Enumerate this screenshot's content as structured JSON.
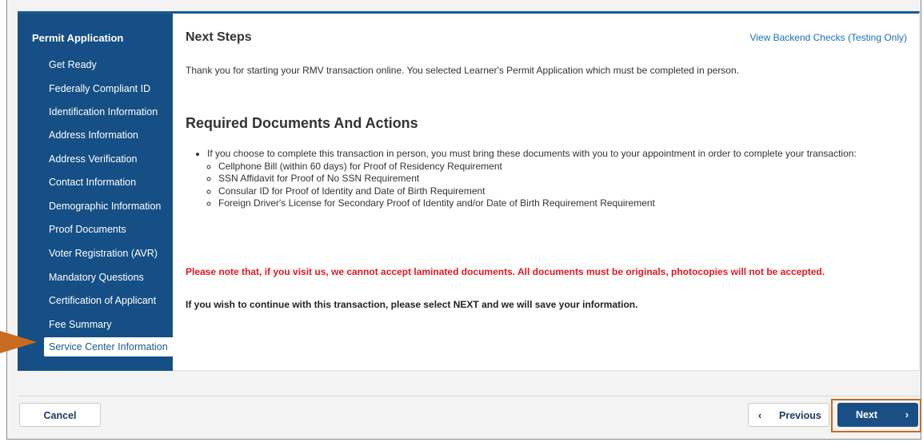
{
  "sidebar": {
    "title": "Permit Application",
    "items": [
      {
        "label": "Get Ready"
      },
      {
        "label": "Federally Compliant ID"
      },
      {
        "label": "Identification Information"
      },
      {
        "label": "Address Information"
      },
      {
        "label": "Address Verification"
      },
      {
        "label": "Contact Information"
      },
      {
        "label": "Demographic Information"
      },
      {
        "label": "Proof Documents"
      },
      {
        "label": "Voter Registration (AVR)"
      },
      {
        "label": "Mandatory Questions"
      },
      {
        "label": "Certification of Applicant"
      },
      {
        "label": "Fee Summary"
      },
      {
        "label": "Service Center Information"
      }
    ],
    "active_index": 12
  },
  "main": {
    "heading": "Next Steps",
    "backend_link": "View Backend Checks (Testing Only)",
    "intro": "Thank you for starting your RMV transaction online. You selected Learner's Permit Application which must be completed in person.",
    "required_heading": "Required Documents And Actions",
    "bullet_intro": "If you choose to complete this transaction in person, you must bring these documents with you to your appointment in order to complete your transaction:",
    "documents": [
      "Cellphone Bill (within 60 days) for Proof of Residency Requirement",
      "SSN Affidavit for Proof of No SSN Requirement",
      "Consular ID for Proof of Identity and Date of Birth Requirement",
      "Foreign Driver's License for Secondary Proof of Identity and/or Date of Birth Requirement Requirement"
    ],
    "warning": "Please note that, if you visit us, we cannot accept laminated documents. All documents must be originals, photocopies will not be accepted.",
    "continue_note": "If you wish to continue with this transaction, please select NEXT and we will save your information."
  },
  "footer": {
    "cancel_label": "Cancel",
    "previous_label": "Previous",
    "next_label": "Next",
    "previous_icon": "‹",
    "next_icon": "›"
  },
  "colors": {
    "sidebar_bg": "#154f85",
    "link": "#1f6fb5",
    "warning": "#e5181e",
    "highlight": "#c96a1e"
  }
}
